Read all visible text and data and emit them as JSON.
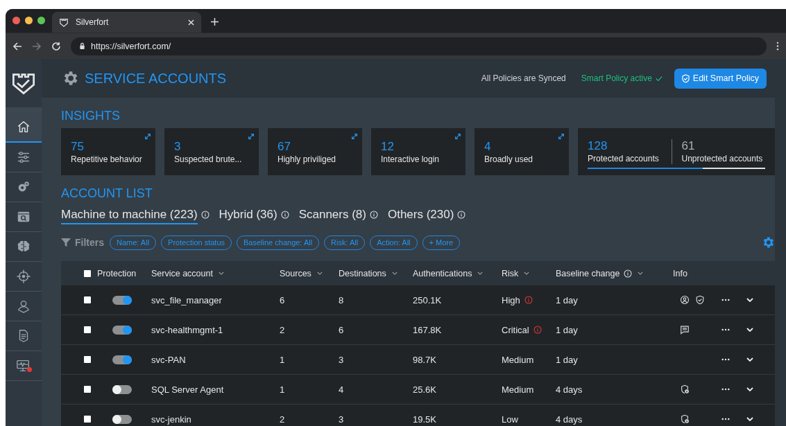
{
  "browser": {
    "tab_title": "Silverfort",
    "url": "https://silverfort.com/"
  },
  "sidebar": {
    "items": [
      {
        "kind": "home",
        "selected": true,
        "alert": false
      },
      {
        "kind": "sliders",
        "selected": false,
        "alert": false
      },
      {
        "kind": "gears",
        "selected": false,
        "alert": false
      },
      {
        "kind": "browser-search",
        "selected": false,
        "alert": false
      },
      {
        "kind": "brain",
        "selected": false,
        "alert": false
      },
      {
        "kind": "crosshair",
        "selected": false,
        "alert": false
      },
      {
        "kind": "user",
        "selected": false,
        "alert": false
      },
      {
        "kind": "document",
        "selected": false,
        "alert": false
      },
      {
        "kind": "monitor",
        "selected": false,
        "alert": true
      }
    ]
  },
  "header": {
    "title": "SERVICE ACCOUNTS",
    "sync_status": "All Policies are Synced",
    "smart_policy": "Smart Policy active",
    "edit_button": "Edit Smart Policy"
  },
  "insights": {
    "title": "INSIGHTS",
    "cards": [
      {
        "value": "75",
        "label": "Repetitive behavior"
      },
      {
        "value": "3",
        "label": "Suspected brute..."
      },
      {
        "value": "67",
        "label": "Highly priviliged"
      },
      {
        "value": "12",
        "label": "Interactive login"
      },
      {
        "value": "4",
        "label": "Broadly used"
      }
    ],
    "summary": {
      "protected_value": "128",
      "protected_label": "Protected accounts",
      "unprotected_value": "61",
      "unprotected_label": "Unprotected accounts",
      "level": 0.65
    }
  },
  "account_list": {
    "title": "ACCOUNT LIST",
    "tabs": [
      {
        "label": "Machine to machine (223)",
        "selected": true
      },
      {
        "label": "Hybrid (36)",
        "selected": false
      },
      {
        "label": "Scanners (8)",
        "selected": false
      },
      {
        "label": "Others (230)",
        "selected": false
      }
    ],
    "filters_label": "Filters",
    "filters": [
      "Name: All",
      "Protection status",
      "Baseline change: All",
      "Risk: All",
      "Action: All",
      "+ More"
    ],
    "table": {
      "select_all": {
        "checked": false
      },
      "columns": [
        {
          "label": "Protection",
          "sortable": false,
          "info": false
        },
        {
          "label": "Service account",
          "sortable": true,
          "info": false
        },
        {
          "label": "Sources",
          "sortable": true,
          "info": false
        },
        {
          "label": "Destinations",
          "sortable": true,
          "info": false
        },
        {
          "label": "Authentications",
          "sortable": true,
          "info": false
        },
        {
          "label": "Risk",
          "sortable": true,
          "info": false
        },
        {
          "label": "Baseline change",
          "sortable": true,
          "info": true
        },
        {
          "label": "Info",
          "sortable": false,
          "info": false
        }
      ],
      "rows": [
        {
          "checked": false,
          "protected": true,
          "service_account": "svc_file_manager",
          "sources": "6",
          "destinations": "8",
          "authentications": "250.1K",
          "risk": "High",
          "risk_alert": true,
          "baseline_change": "1 day",
          "info": [
            {
              "kind": "person"
            },
            {
              "kind": "shield-check"
            }
          ]
        },
        {
          "checked": false,
          "protected": true,
          "service_account": "svc-healthmgmt-1",
          "sources": "2",
          "destinations": "6",
          "authentications": "167.8K",
          "risk": "Critical",
          "risk_alert": true,
          "baseline_change": "1 day",
          "info": [
            {
              "kind": "message"
            }
          ]
        },
        {
          "checked": false,
          "protected": true,
          "service_account": "svc-PAN",
          "sources": "1",
          "destinations": "3",
          "authentications": "98.7K",
          "risk": "Medium",
          "risk_alert": false,
          "baseline_change": "1 day",
          "info": []
        },
        {
          "checked": false,
          "protected": false,
          "service_account": "SQL Server Agent",
          "sources": "1",
          "destinations": "4",
          "authentications": "25.6K",
          "risk": "Medium",
          "risk_alert": false,
          "baseline_change": "4 days",
          "info": [
            {
              "kind": "shield-lock"
            }
          ]
        },
        {
          "checked": false,
          "protected": false,
          "service_account": "svc-jenkin",
          "sources": "2",
          "destinations": "3",
          "authentications": "19.5K",
          "risk": "Low",
          "risk_alert": false,
          "baseline_change": "4 days",
          "info": [
            {
              "kind": "shield-lock"
            }
          ]
        }
      ]
    }
  }
}
